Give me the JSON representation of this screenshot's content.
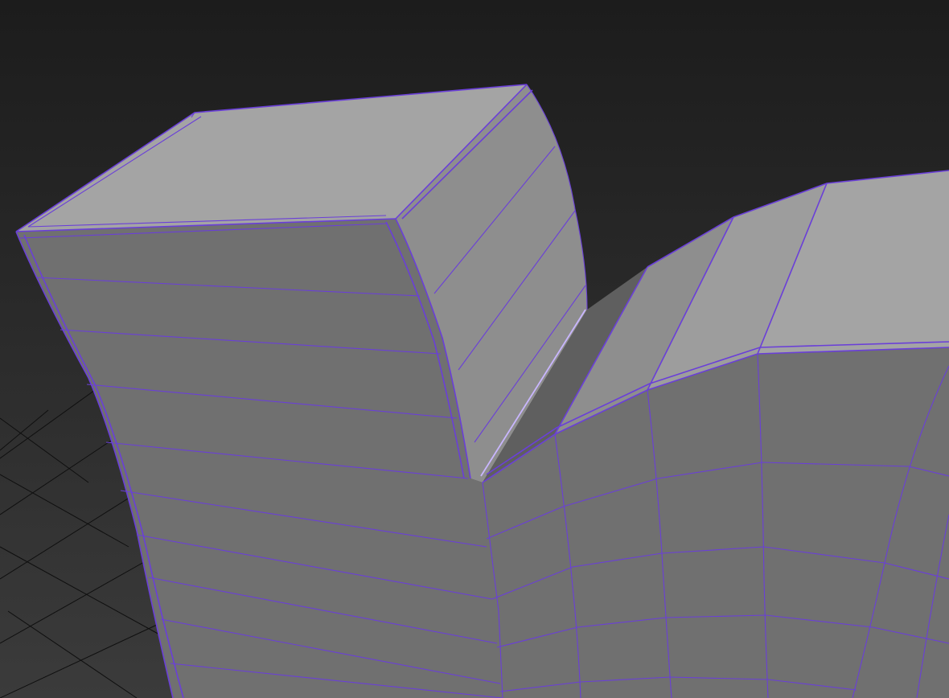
{
  "viewport": {
    "kind": "3d-modeling-viewport",
    "view": "perspective",
    "shading": "flat-shaded-with-edged-faces",
    "colors": {
      "background_top": "#1c1c1c",
      "background_bottom": "#3b3b3b",
      "grid_line": "#0f0f0f",
      "wireframe_edge": "#6a3fd8",
      "edge_highlight": "#c9b6ff",
      "face_top": "#a4a4a4",
      "face_side_light": "#8e8e8e",
      "face_front": "#707070",
      "face_inner": "#5f5f5f"
    }
  },
  "icons": {
    "mesh": "polygon-mesh-icon",
    "grid": "ground-grid-icon"
  }
}
